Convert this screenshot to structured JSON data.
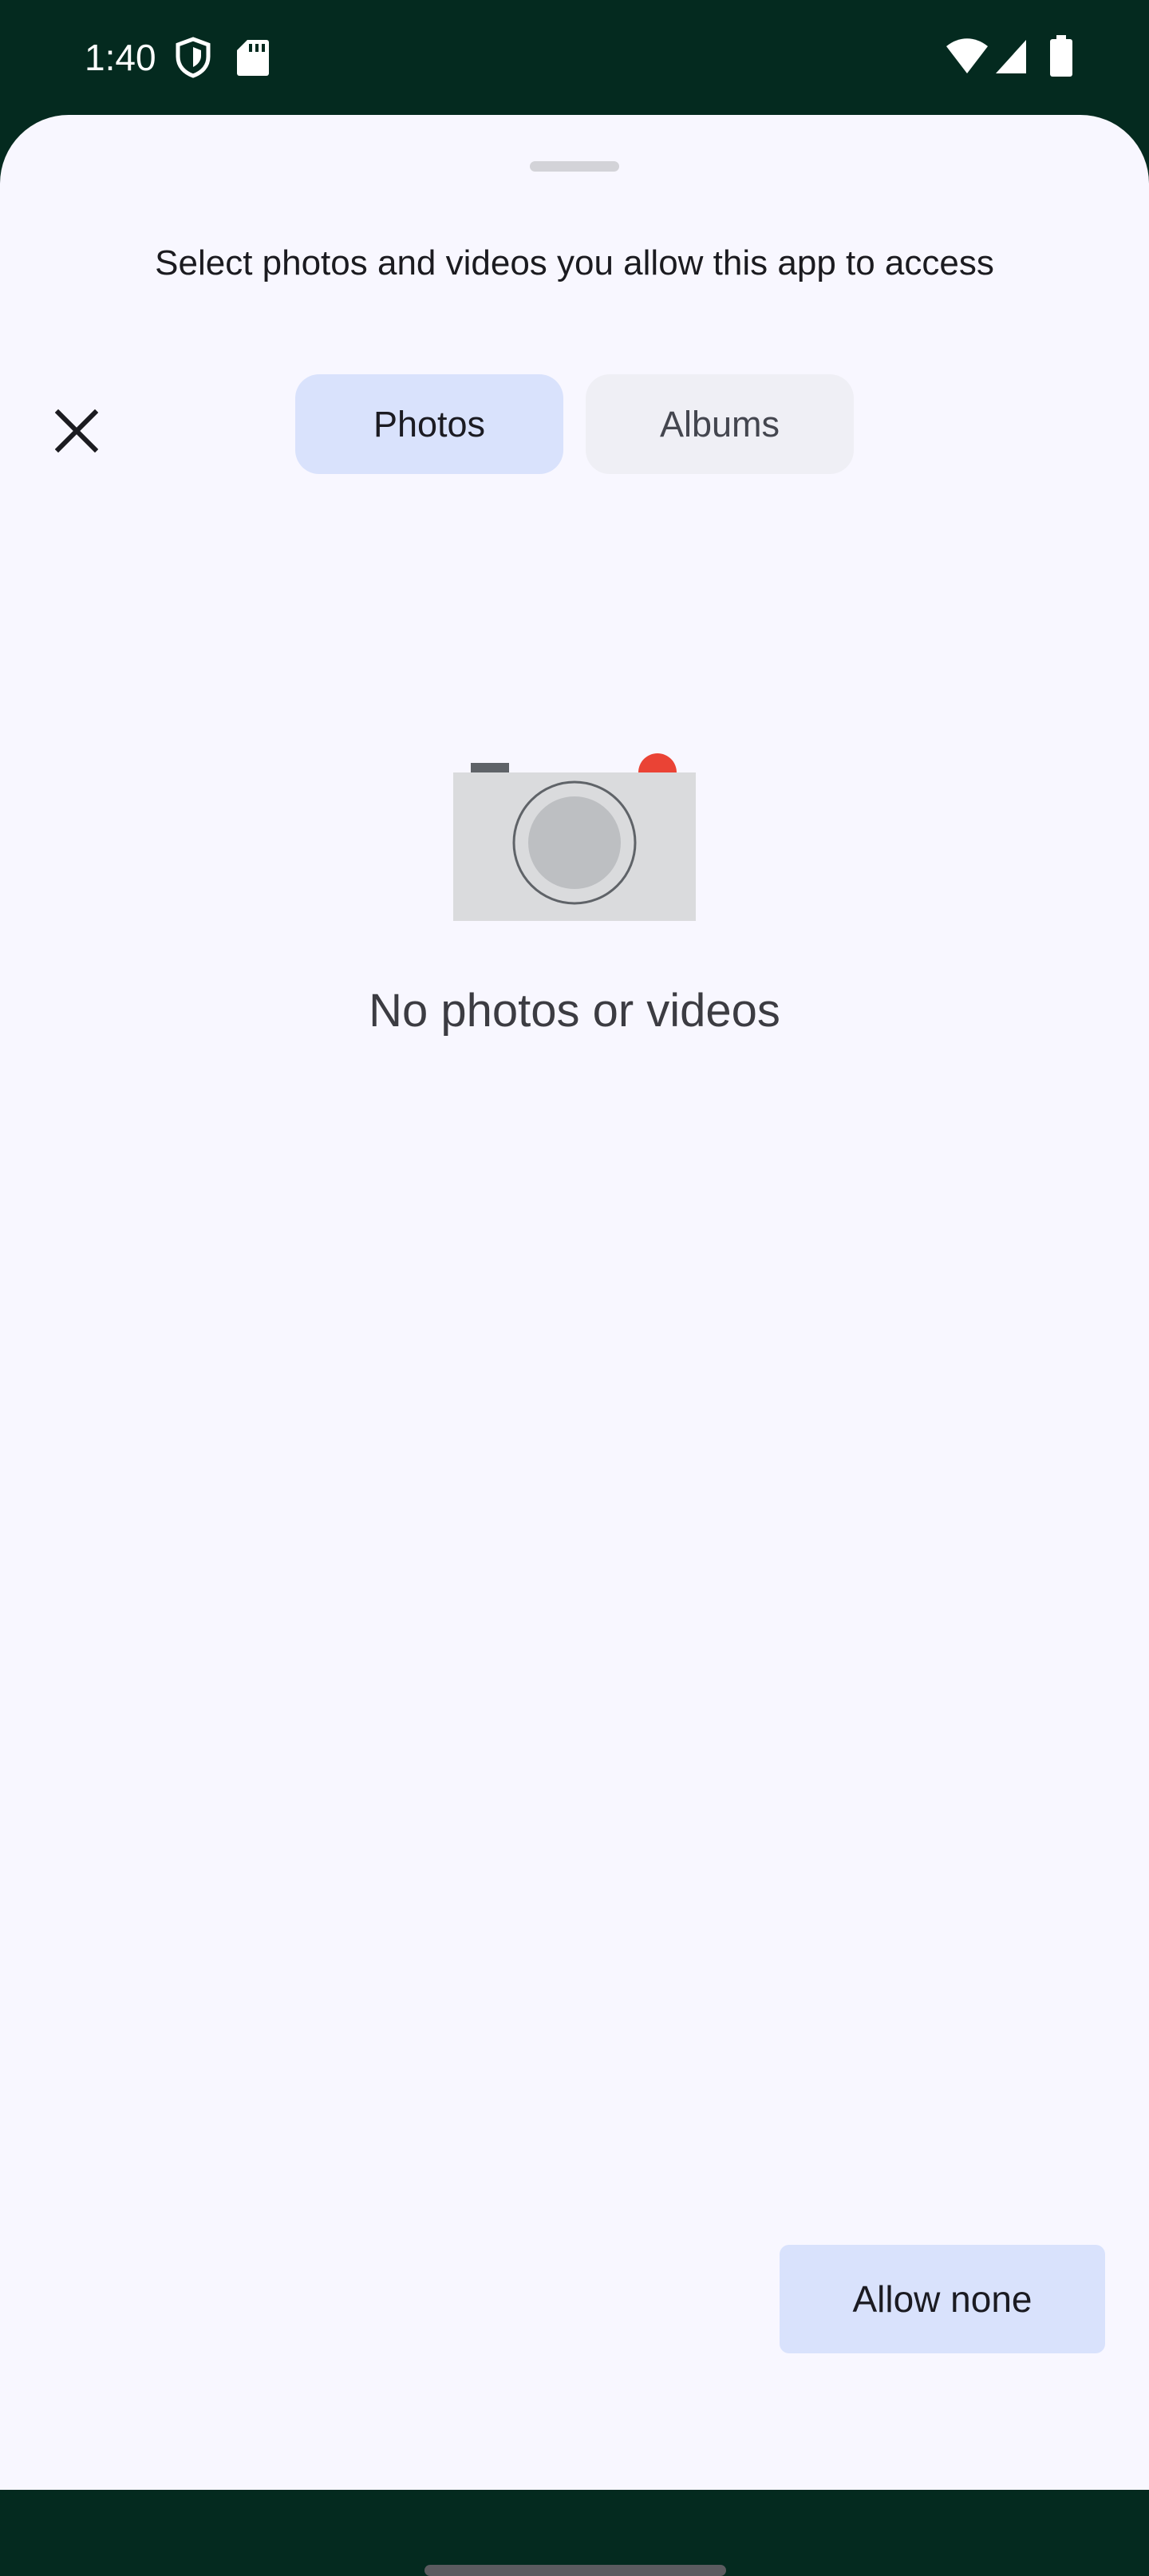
{
  "status_bar": {
    "time": "1:40",
    "icons": [
      "shield-icon",
      "sd-card-icon",
      "wifi-icon",
      "signal-icon",
      "battery-icon"
    ]
  },
  "sheet": {
    "title": "Select photos and videos you allow this app to access",
    "close_icon": "close-icon",
    "tabs": [
      {
        "label": "Photos",
        "selected": true
      },
      {
        "label": "Albums",
        "selected": false
      }
    ],
    "empty_state": {
      "icon": "camera-icon",
      "message": "No photos or videos"
    },
    "allow_none_label": "Allow none"
  },
  "colors": {
    "status_bar_bg": "#042a1f",
    "sheet_bg": "#f8f7ff",
    "selected_tab_bg": "#d9e2fc",
    "unselected_tab_bg": "#efeff5",
    "camera_accent": "#ea4335"
  }
}
